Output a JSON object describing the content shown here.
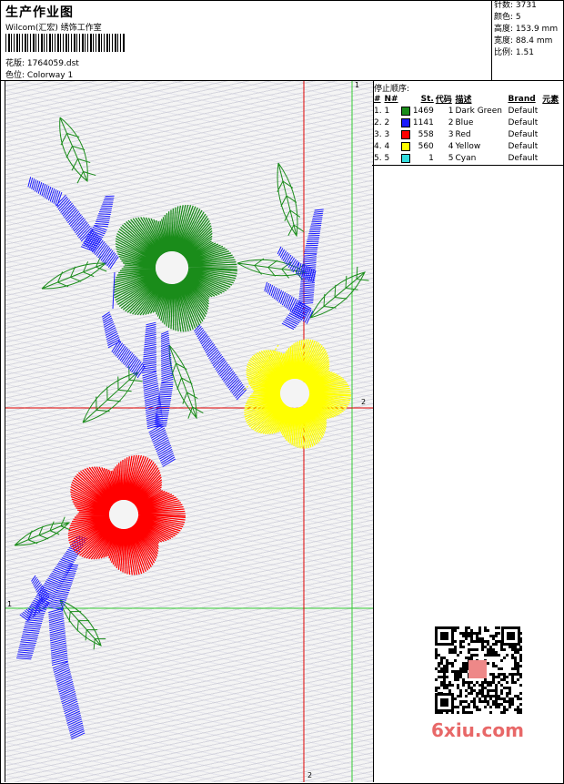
{
  "header": {
    "title": "生产作业图",
    "company": "Wilcom(汇宏) 绣饰工作室",
    "design_label": "花版:",
    "design_value": "1764059.dst",
    "colorway_label": "色位:",
    "colorway_value": "Colorway 1"
  },
  "stats": [
    {
      "label": "针数:",
      "value": "3731"
    },
    {
      "label": "颜色:",
      "value": "5"
    },
    {
      "label": "高度:",
      "value": "153.9 mm"
    },
    {
      "label": "宽度:",
      "value": "88.4 mm"
    },
    {
      "label": "比例:",
      "value": "1.51"
    }
  ],
  "stop_sequence": {
    "title": "停止顺序:",
    "columns": [
      "#",
      "N#",
      "St.",
      "代码",
      "描述",
      "Brand",
      "元素"
    ],
    "rows": [
      {
        "n": "1.",
        "nn": "1",
        "color": "#1a8c1a",
        "st": "1469",
        "code": "1",
        "desc": "Dark Green",
        "brand": "Default"
      },
      {
        "n": "2.",
        "nn": "2",
        "color": "#1a1aff",
        "st": "1141",
        "code": "2",
        "desc": "Blue",
        "brand": "Default"
      },
      {
        "n": "3.",
        "nn": "3",
        "color": "#ff0000",
        "st": "558",
        "code": "3",
        "desc": "Red",
        "brand": "Default"
      },
      {
        "n": "4.",
        "nn": "4",
        "color": "#ffff00",
        "st": "560",
        "code": "4",
        "desc": "Yellow",
        "brand": "Default"
      },
      {
        "n": "5.",
        "nn": "5",
        "color": "#33dddd",
        "st": "1",
        "code": "5",
        "desc": "Cyan",
        "brand": "Default"
      }
    ]
  },
  "guides": {
    "v1": "1",
    "v2": "2",
    "h1": "1",
    "h2": "2"
  },
  "watermark": "6xiu.com",
  "colors": {
    "dark_green": "#1a8c1a",
    "blue": "#1a1aff",
    "red": "#ff0000",
    "yellow": "#ffff00",
    "guide_red": "#e00000",
    "guide_green": "#33cc33"
  }
}
